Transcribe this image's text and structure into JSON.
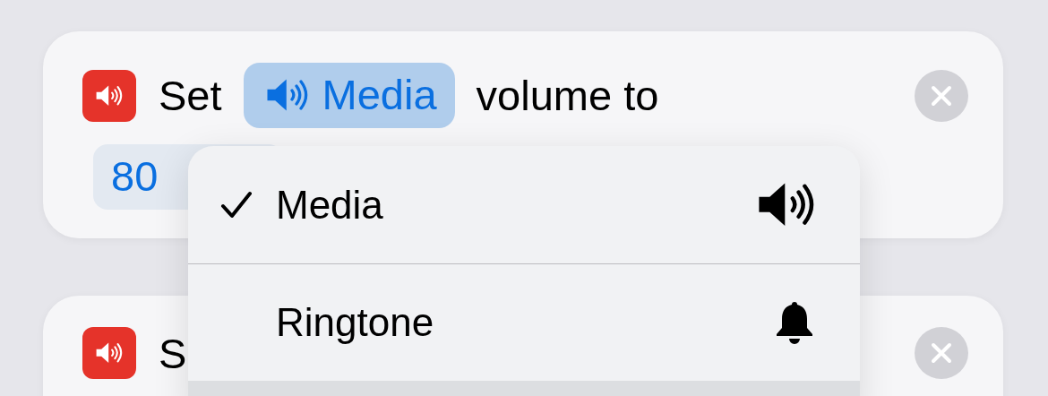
{
  "actions": [
    {
      "kind": "set_volume",
      "prefix": "Set",
      "target": "Media",
      "suffix": "volume to",
      "value": "80"
    },
    {
      "kind": "set_volume",
      "prefix": "S"
    }
  ],
  "menu": {
    "items": [
      {
        "kind": "media",
        "label": "Media",
        "selected": true
      },
      {
        "kind": "ringtone",
        "label": "Ringtone",
        "selected": false
      }
    ]
  }
}
